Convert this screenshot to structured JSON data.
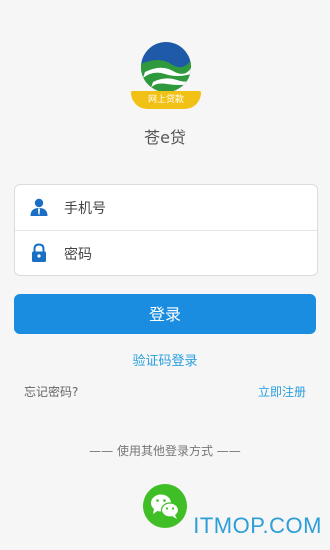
{
  "brand": {
    "logo_banner": "网上贷款",
    "app_name": "苍e贷"
  },
  "form": {
    "phone_placeholder": "手机号",
    "password_placeholder": "密码"
  },
  "actions": {
    "login_label": "登录",
    "sms_login_label": "验证码登录",
    "forgot_password_label": "忘记密码?",
    "register_label": "立即注册"
  },
  "other_login": {
    "divider_text": "—— 使用其他登录方式 ——",
    "wechat_icon": "wechat-icon"
  },
  "watermark": "ITMOP.COM",
  "colors": {
    "primary": "#1a8de0",
    "link": "#2a9fe0",
    "wechat": "#3fbf25",
    "logo_gold": "#f2c116",
    "background": "#f6f6f6"
  }
}
